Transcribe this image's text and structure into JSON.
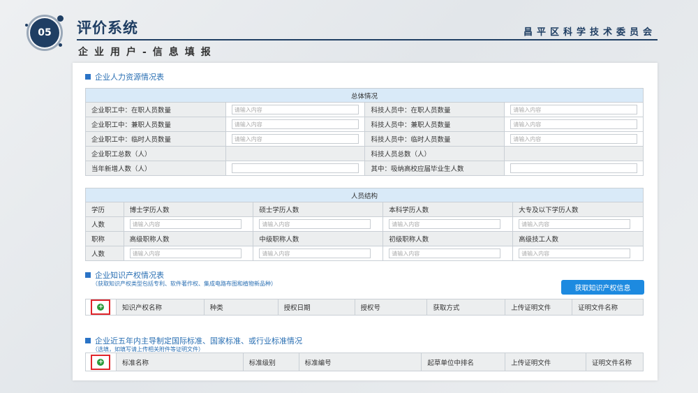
{
  "header": {
    "number": "05",
    "title": "评价系统",
    "org": "昌平区科学技术委员会",
    "subtitle": "企业用户-信息填报"
  },
  "hr": {
    "section_title": "企业人力资源情况表",
    "table_header": "总体情况",
    "placeholder": "请输入内容",
    "rows": [
      {
        "left": "企业职工中：在职人员数量",
        "right": "科技人员中：在职人员数量"
      },
      {
        "left": "企业职工中：兼职人员数量",
        "right": "科技人员中：兼职人员数量"
      },
      {
        "left": "企业职工中：临时人员数量",
        "right": "科技人员中：临时人员数量"
      },
      {
        "left": "企业职工总数（人）",
        "right": "科技人员总数（人）"
      },
      {
        "left": "当年新增人数（人）",
        "right": "其中：吸纳高校应届毕业生人数"
      }
    ]
  },
  "structure": {
    "table_header": "人员结构",
    "row1_label": "学历",
    "row1": [
      "博士学历人数",
      "硕士学历人数",
      "本科学历人数",
      "大专及以下学历人数"
    ],
    "row2_label": "人数",
    "row3_label": "职称",
    "row3": [
      "高级职称人数",
      "中级职称人数",
      "初级职称人数",
      "高级技工人数"
    ],
    "row4_label": "人数"
  },
  "ip": {
    "section_title": "企业知识产权情况表",
    "note": "（获取知识产权类型包括专利、软件著作权、集成电路布图和植物新品种）",
    "button": "获取知识产权信息",
    "columns": [
      "知识产权名称",
      "种类",
      "授权日期",
      "授权号",
      "获取方式",
      "上传证明文件",
      "证明文件名称"
    ]
  },
  "std": {
    "section_title": "企业近五年内主导制定国际标准、国家标准、或行业标准情况",
    "note": "（选填，如填写请上传相关附件等证明文件）",
    "columns": [
      "标准名称",
      "标准级别",
      "标准编号",
      "起草单位中排名",
      "上传证明文件",
      "证明文件名称"
    ]
  },
  "icons": {
    "add": "plus-circle-icon"
  },
  "colors": {
    "brand": "#1f3e63",
    "accent": "#1d8ae0",
    "highlight": "#e0242a",
    "add": "#2a9a3a"
  }
}
